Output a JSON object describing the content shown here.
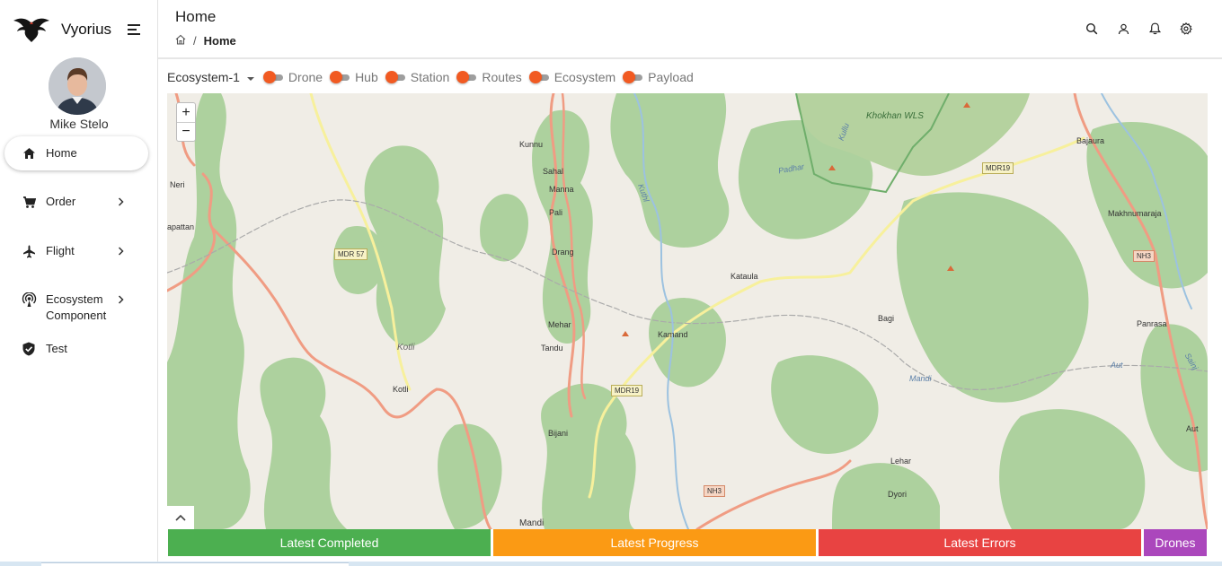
{
  "brand": {
    "name": "Vyorius"
  },
  "user": {
    "name": "Mike Stelo"
  },
  "sidebar": {
    "items": [
      {
        "label": "Home",
        "icon": "home-icon"
      },
      {
        "label": "Order",
        "icon": "cart-icon"
      },
      {
        "label": "Flight",
        "icon": "airplane-icon"
      },
      {
        "label": "Ecosystem Component",
        "icon": "broadcast-icon"
      },
      {
        "label": "Test",
        "icon": "shield-check-icon"
      }
    ]
  },
  "header": {
    "title": "Home",
    "breadcrumb": {
      "separator": "/",
      "current": "Home"
    },
    "icons": [
      "search-icon",
      "user-icon",
      "bell-icon",
      "gear-icon"
    ]
  },
  "filter": {
    "ecosystem_value": "Ecosystem-1",
    "toggles": [
      {
        "label": "Drone",
        "on": false
      },
      {
        "label": "Hub",
        "on": false
      },
      {
        "label": "Station",
        "on": false
      },
      {
        "label": "Routes",
        "on": false
      },
      {
        "label": "Ecosystem",
        "on": false
      },
      {
        "label": "Payload",
        "on": false
      }
    ],
    "toggle_color": "#f15a22"
  },
  "map": {
    "zoom_in": "+",
    "zoom_out": "−",
    "places": {
      "khokhan": "Khokhan WLS",
      "bajaura": "Bajaura",
      "kunnu": "Kunnu",
      "sahal": "Sahal",
      "manna": "Manna",
      "pali": "Pali",
      "drang": "Drang",
      "mehar": "Mehar",
      "tandu": "Tandu",
      "kataula": "Kataula",
      "kamand": "Kamand",
      "bagi": "Bagi",
      "makhnumaraja": "Makhnumaraja",
      "panrasa": "Panrasa",
      "aut": "Aut",
      "aut_river": "Aut",
      "lehar": "Lehar",
      "dyori": "Dyori",
      "bijani": "Bijani",
      "kotli": "Kotli",
      "kotli_it": "Kotli",
      "neri": "Neri",
      "apattan": "apattan",
      "mandi": "Mandi",
      "mandi_river": "Mandi",
      "padhar": "Padhar",
      "kullu": "Kullu",
      "sainj": "Sainj",
      "kuthl": "Kuthl"
    },
    "shields": {
      "mdr57": "MDR 57",
      "mdr19a": "MDR19",
      "mdr19b": "MDR19",
      "nh3a": "NH3",
      "nh3b": "NH3"
    }
  },
  "tabs": [
    {
      "label": "Latest Completed",
      "color": "#4caf50"
    },
    {
      "label": "Latest Progress",
      "color": "#fb9a14"
    },
    {
      "label": "Latest Errors",
      "color": "#e84342"
    },
    {
      "label": "Drones",
      "color": "#ab47bc"
    }
  ]
}
